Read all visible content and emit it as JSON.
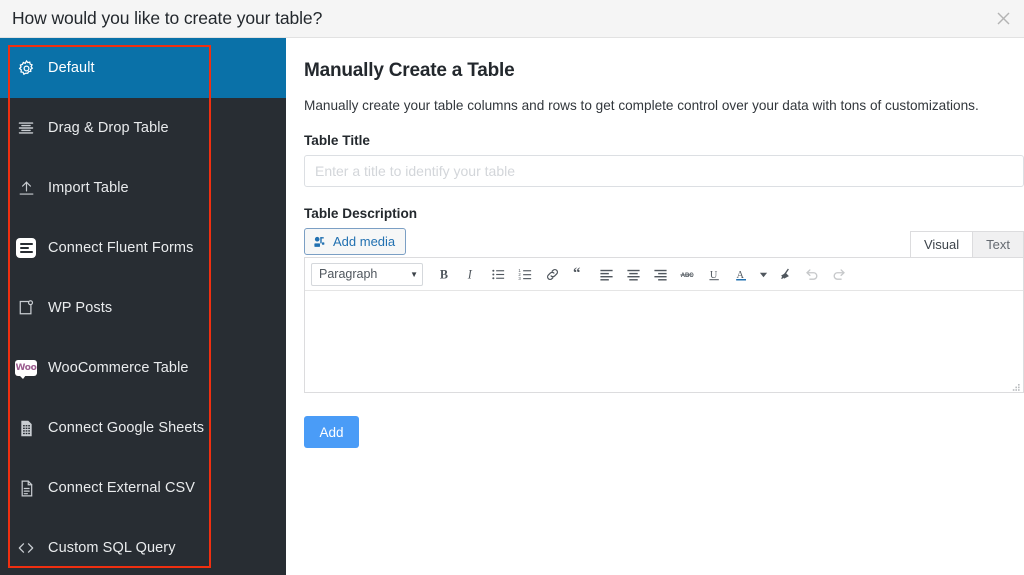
{
  "header": {
    "title": "How would you like to create your table?",
    "close_icon": "close-icon"
  },
  "sidebar": {
    "items": [
      {
        "label": "Default",
        "icon": "gear-icon",
        "active": true
      },
      {
        "label": "Drag & Drop Table",
        "icon": "drag-drop-icon",
        "active": false
      },
      {
        "label": "Import Table",
        "icon": "upload-icon",
        "active": false
      },
      {
        "label": "Connect Fluent Forms",
        "icon": "fluent-forms-icon",
        "active": false
      },
      {
        "label": "WP Posts",
        "icon": "wp-posts-icon",
        "active": false
      },
      {
        "label": "WooCommerce Table",
        "icon": "woocommerce-icon",
        "active": false
      },
      {
        "label": "Connect Google Sheets",
        "icon": "google-sheets-icon",
        "active": false
      },
      {
        "label": "Connect External CSV",
        "icon": "csv-file-icon",
        "active": false
      },
      {
        "label": "Custom SQL Query",
        "icon": "code-brackets-icon",
        "active": false
      }
    ]
  },
  "main": {
    "title": "Manually Create a Table",
    "description": "Manually create your table columns and rows to get complete control over your data with tons of customizations.",
    "table_title": {
      "label": "Table Title",
      "value": "",
      "placeholder": "Enter a title to identify your table"
    },
    "table_description": {
      "label": "Table Description",
      "add_media_label": "Add media",
      "add_media_icon": "media-icon",
      "tabs": [
        {
          "label": "Visual",
          "active": true
        },
        {
          "label": "Text",
          "active": false
        }
      ],
      "format_select": {
        "value": "Paragraph",
        "caret_icon": "chevron-down-icon"
      },
      "toolbar_buttons": [
        {
          "name": "bold-icon",
          "label": "B"
        },
        {
          "name": "italic-icon",
          "label": "I"
        },
        {
          "name": "bullet-list-icon",
          "label": ""
        },
        {
          "name": "numbered-list-icon",
          "label": ""
        },
        {
          "name": "link-icon",
          "label": ""
        },
        {
          "name": "blockquote-icon",
          "label": ""
        },
        {
          "name": "align-left-icon",
          "label": ""
        },
        {
          "name": "align-center-icon",
          "label": ""
        },
        {
          "name": "align-right-icon",
          "label": ""
        },
        {
          "name": "strikethrough-icon",
          "label": "ABC"
        },
        {
          "name": "underline-icon",
          "label": "U"
        },
        {
          "name": "text-color-icon",
          "label": "A"
        },
        {
          "name": "text-color-caret-icon",
          "label": ""
        },
        {
          "name": "clear-formatting-icon",
          "label": ""
        },
        {
          "name": "undo-icon",
          "label": ""
        },
        {
          "name": "redo-icon",
          "label": ""
        }
      ],
      "content": "",
      "resize_handle_icon": "resize-grip-icon"
    },
    "submit_label": "Add"
  },
  "colors": {
    "accent_blue": "#0a71a8",
    "sidebar_bg": "#282d33",
    "annotation_red": "#f02f10",
    "button_blue": "#4a9cf7",
    "link_blue": "#2271b1"
  }
}
